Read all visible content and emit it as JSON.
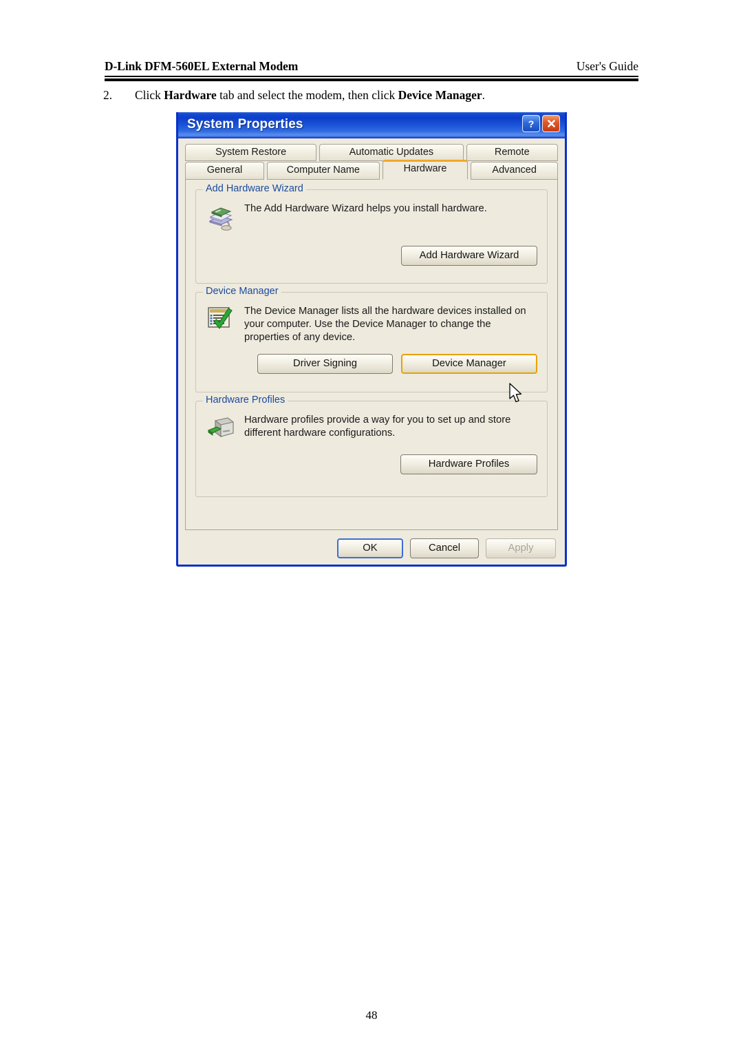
{
  "document": {
    "header_left": "D-Link DFM-560EL External Modem",
    "header_right": "User's Guide",
    "page_number": "48",
    "instruction": {
      "number": "2.",
      "part1": "Click ",
      "bold1": "Hardware",
      "part2": " tab and select the modem, then click ",
      "bold2": "Device Manager",
      "part3": "."
    }
  },
  "dialog": {
    "title": "System Properties",
    "title_buttons": [
      {
        "name": "help-button",
        "label": "?"
      },
      {
        "name": "close-button",
        "label": "✕"
      }
    ],
    "tabs_row1": [
      {
        "label": "System Restore",
        "active": false
      },
      {
        "label": "Automatic Updates",
        "active": false
      },
      {
        "label": "Remote",
        "active": false
      }
    ],
    "tabs_row2": [
      {
        "label": "General",
        "active": false
      },
      {
        "label": "Computer Name",
        "active": false
      },
      {
        "label": "Hardware",
        "active": true
      },
      {
        "label": "Advanced",
        "active": false
      }
    ],
    "groups": [
      {
        "title": "Add Hardware Wizard",
        "icon": "add-hardware-wizard-icon",
        "description": "The Add Hardware Wizard helps you install hardware.",
        "buttons": [
          {
            "label": "Add Hardware Wizard",
            "highlighted": false,
            "disabled": false
          }
        ]
      },
      {
        "title": "Device Manager",
        "icon": "device-manager-icon",
        "description": "The Device Manager lists all the hardware devices installed on your computer. Use the Device Manager to change the properties of any device.",
        "buttons": [
          {
            "label": "Driver Signing",
            "highlighted": false,
            "disabled": false
          },
          {
            "label": "Device Manager",
            "highlighted": true,
            "disabled": false
          }
        ]
      },
      {
        "title": "Hardware Profiles",
        "icon": "hardware-profiles-icon",
        "description": "Hardware profiles provide a way for you to set up and store different hardware configurations.",
        "buttons": [
          {
            "label": "Hardware Profiles",
            "highlighted": false,
            "disabled": false
          }
        ]
      }
    ],
    "footer_buttons": [
      {
        "label": "OK",
        "state": "default"
      },
      {
        "label": "Cancel",
        "state": "normal"
      },
      {
        "label": "Apply",
        "state": "disabled"
      }
    ]
  },
  "colors": {
    "titlebar_blue": "#0c3ecb",
    "dialog_face": "#eeeade",
    "group_title_blue": "#1b4b9c",
    "highlight_orange": "#e8a200",
    "default_button_blue": "#3b6fd4"
  }
}
